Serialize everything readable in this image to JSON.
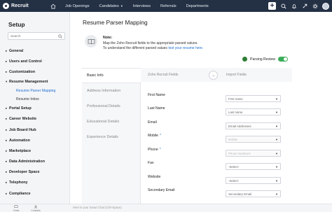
{
  "app": {
    "name": "Recruit"
  },
  "topnav": {
    "home_icon": "home-icon",
    "items": [
      "Job Openings",
      "Candidates",
      "Interviews",
      "Referrals",
      "Departments"
    ],
    "candidates_has_dropdown": true
  },
  "topright": {
    "plus_label": "+",
    "icons": [
      "search-icon",
      "bell-icon",
      "rocket-icon",
      "gear-icon",
      "avatar"
    ]
  },
  "sidebar": {
    "title": "Setup",
    "search_placeholder": "Search",
    "items": [
      {
        "label": "General",
        "expanded": false
      },
      {
        "label": "Users and Control",
        "expanded": false
      },
      {
        "label": "Customization",
        "expanded": false
      },
      {
        "label": "Resume Management",
        "expanded": true
      },
      {
        "label": "Portal Setup",
        "expanded": false
      },
      {
        "label": "Career Website",
        "expanded": false
      },
      {
        "label": "Job Board Hub",
        "expanded": false
      },
      {
        "label": "Automation",
        "expanded": false
      },
      {
        "label": "Marketplace",
        "expanded": false
      },
      {
        "label": "Data Administration",
        "expanded": false
      },
      {
        "label": "Developer Space",
        "expanded": false
      },
      {
        "label": "Telephony",
        "expanded": false
      },
      {
        "label": "Compliance",
        "expanded": false
      }
    ],
    "subitems": [
      {
        "label": "Resume Parser Mapping",
        "active": true
      },
      {
        "label": "Resume Inbox",
        "active": false
      }
    ]
  },
  "main": {
    "title": "Resume Parser Mapping",
    "note": {
      "heading": "Note:",
      "line1": "Map the Zoho Recruit fields to the appropriate parsed values.",
      "line2_prefix": "To understand the different parsed values ",
      "line2_link": "test your resume here."
    },
    "parsing_review": {
      "label": "Parsing Review",
      "enabled": true
    },
    "tabs": [
      {
        "label": "Basic Info",
        "active": true
      },
      {
        "label": "Address Information",
        "active": false
      },
      {
        "label": "Professional Details",
        "active": false
      },
      {
        "label": "Educational Details",
        "active": false
      },
      {
        "label": "Experience Details",
        "active": false
      }
    ],
    "fields_header": {
      "left": "Zoho Recruit Fields",
      "right": "Import Fields"
    },
    "fields": [
      {
        "label": "First Name",
        "required": false,
        "value": "First name",
        "disabled": false
      },
      {
        "label": "Last Name",
        "required": false,
        "value": "Last name",
        "disabled": false
      },
      {
        "label": "Email",
        "required": false,
        "value": "Email Addresses",
        "disabled": false
      },
      {
        "label": "Mobile",
        "required": true,
        "value": "Mobile",
        "disabled": true
      },
      {
        "label": "Phone",
        "required": true,
        "value": "Phone Numbers",
        "disabled": true
      },
      {
        "label": "Fax",
        "required": false,
        "value": "-Select-",
        "disabled": false
      },
      {
        "label": "Website",
        "required": false,
        "value": "-Select-",
        "disabled": false
      },
      {
        "label": "Secondary Email",
        "required": false,
        "value": "Secondary Email",
        "disabled": false
      }
    ]
  },
  "bottombar": {
    "buttons": [
      "Chats",
      "Contacts"
    ],
    "chat_placeholder": "Here is your Smart Chat (Ctrl+Space)"
  }
}
